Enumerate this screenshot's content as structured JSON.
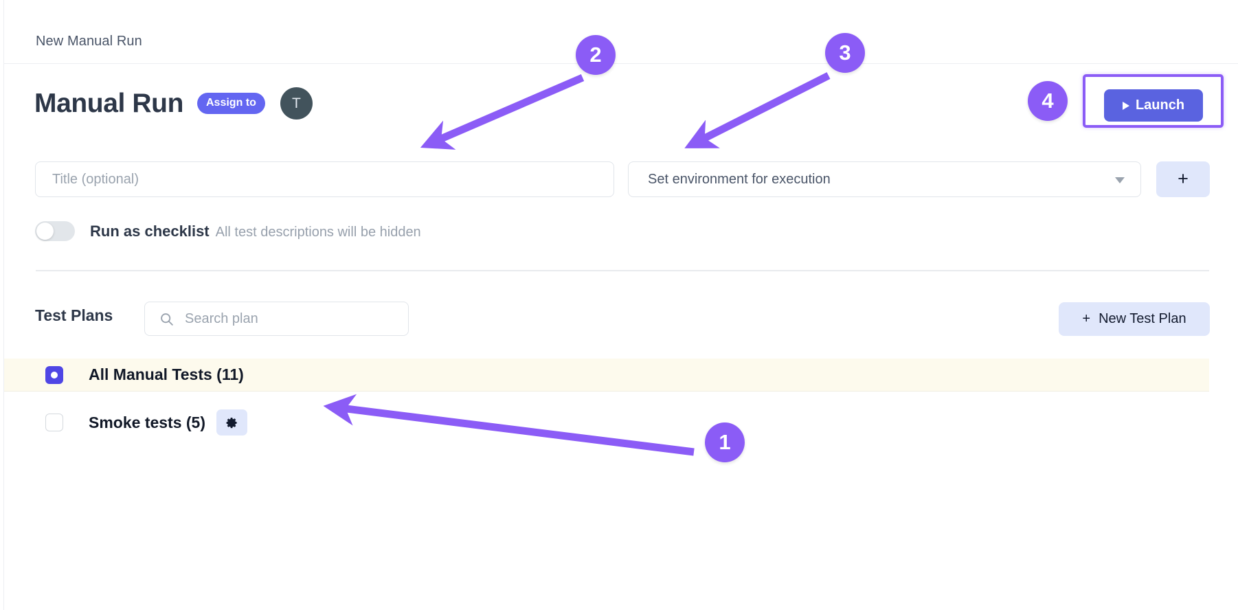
{
  "breadcrumb": {
    "label": "New Manual Run"
  },
  "header": {
    "title": "Manual Run",
    "assign_label": "Assign to",
    "avatar_initial": "T",
    "launch_label": "Launch",
    "launch_icon": "play-triangle-icon"
  },
  "form": {
    "title_value": "",
    "title_placeholder": "Title (optional)",
    "environment_value": "Set environment for execution",
    "environment_caret_icon": "chevron-down-icon",
    "add_environment_label": "+",
    "add_environment_icon": "plus-icon"
  },
  "checklist": {
    "label": "Run as checklist",
    "description": "All test descriptions will be hidden",
    "enabled": false
  },
  "test_plans": {
    "section_title": "Test Plans",
    "search_value": "",
    "search_placeholder": "Search plan",
    "search_icon": "search-icon",
    "new_plan_label": "New Test Plan",
    "new_plan_icon": "plus-icon",
    "rows": [
      {
        "name": "All Manual Tests (11)",
        "checked": true,
        "has_settings": false,
        "highlighted": true
      },
      {
        "name": "Smoke tests (5)",
        "checked": false,
        "has_settings": true,
        "highlighted": false,
        "settings_icon": "gear-icon"
      }
    ]
  },
  "annotations": {
    "accent_color": "#8b5cf6",
    "markers": [
      {
        "label": "1",
        "target": "test-plan-row-smoke-tests"
      },
      {
        "label": "2",
        "target": "title-input"
      },
      {
        "label": "3",
        "target": "environment-select"
      },
      {
        "label": "4",
        "target": "launch-button"
      }
    ]
  },
  "colors": {
    "brand_purple": "#6366f1",
    "launch_blue": "#5a63e0",
    "highlight_row": "#fdfaed",
    "soft_blue_button": "#e0e7fb",
    "checkbox_checked": "#4f46e5",
    "avatar_bg": "#42535c"
  }
}
